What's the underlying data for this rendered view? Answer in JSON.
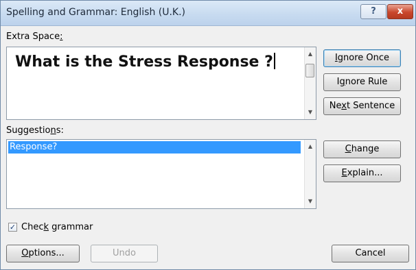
{
  "window": {
    "title": "Spelling and Grammar: English (U.K.)",
    "help_icon": "?",
    "close_icon": "x"
  },
  "issue": {
    "label_prefix": "Extra Space",
    "label_suffix": ":",
    "sentence": "What is the Stress Response ?"
  },
  "suggestions": {
    "label_prefix": "Suggestio",
    "label_mnemonic": "n",
    "label_suffix": "s:",
    "items": [
      "Response?"
    ]
  },
  "buttons": {
    "ignore_once": {
      "m": "I",
      "rest": "gnore Once"
    },
    "ignore_rule": {
      "pre": "I",
      "m": "g",
      "rest": "nore Rule"
    },
    "next_sentence": {
      "pre": "Ne",
      "m": "x",
      "rest": "t Sentence"
    },
    "change": {
      "m": "C",
      "rest": "hange"
    },
    "explain": {
      "m": "E",
      "rest": "xplain..."
    },
    "options": {
      "m": "O",
      "rest": "ptions..."
    },
    "undo": "Undo",
    "cancel": "Cancel"
  },
  "check_grammar": {
    "pre": "Chec",
    "m": "k",
    "rest": " grammar",
    "checked": true
  },
  "colors": {
    "selection": "#3399ff",
    "window_bg": "#f0f0f0",
    "close_red": "#c9472c"
  }
}
